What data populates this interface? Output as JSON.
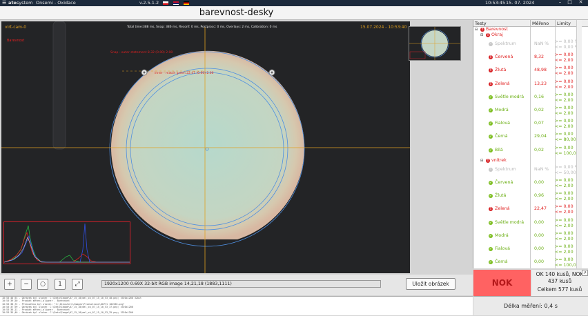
{
  "titlebar": {
    "brand_bold": "ate",
    "brand_rest": "system",
    "app_title": "Onsemi - Oxidace",
    "version": "v.2.5.1.2",
    "time": "10:53:45",
    "date": "15. 07. 2024",
    "menu_icon": "hamburger-icon",
    "minimize": "–",
    "maximize": "□",
    "close": "✕"
  },
  "header": {
    "title": "barevnost-desky"
  },
  "camera": {
    "cam_name": "virt-cam-0",
    "stats": "Total time:388 ms, Snap: 386 ms, Reconf: 0 ms, Postprocc: 0 ms, Overlays: 2 ms, Calibration: 0 ms",
    "timestamp": "15.07.2024 - 10:53:40",
    "label_barevnost": "Barevnost",
    "annot_outer": "Snap - outer statement 8.32 (0.00) 2.00",
    "annot_inner": "inner - match green 22.47 (0.00) 2.00"
  },
  "tree": {
    "col_tests": "Testy",
    "col_measured": "Měřeno",
    "col_limits": "Limity",
    "root_label": "Barevnost",
    "groups": [
      {
        "name": "Okraj",
        "items": [
          {
            "name": "Spektrum",
            "status": "na",
            "value": "NaN %",
            "lim_min": ">= 0,00 %",
            "lim_max": "<= 0,00 %"
          },
          {
            "name": "Červená",
            "status": "err",
            "value": "8,32",
            "lim_min": ">= 0,00",
            "lim_max": "<= 2,00"
          },
          {
            "name": "Žlutá",
            "status": "err",
            "value": "48,98",
            "lim_min": ">= 0,00",
            "lim_max": "<= 2,00"
          },
          {
            "name": "Zelená",
            "status": "err",
            "value": "13,23",
            "lim_min": ">= 0,00",
            "lim_max": "<= 2,00"
          },
          {
            "name": "Světle modrá",
            "status": "ok",
            "value": "0,16",
            "lim_min": ">= 0,00",
            "lim_max": "<= 2,00"
          },
          {
            "name": "Modrá",
            "status": "ok",
            "value": "0,02",
            "lim_min": ">= 0,00",
            "lim_max": "<= 2,00"
          },
          {
            "name": "Fialová",
            "status": "ok",
            "value": "0,07",
            "lim_min": ">= 0,00",
            "lim_max": "<= 2,00"
          },
          {
            "name": "Černá",
            "status": "ok",
            "value": "29,04",
            "lim_min": ">= 0,00",
            "lim_max": "<= 80,00"
          },
          {
            "name": "Bílá",
            "status": "ok",
            "value": "0,02",
            "lim_min": ">= 0,00",
            "lim_max": "<= 100,00"
          }
        ]
      },
      {
        "name": "vnitrek",
        "items": [
          {
            "name": "Spektrum",
            "status": "na",
            "value": "NaN %",
            "lim_min": ">= 0,00 %",
            "lim_max": "<= 50,00 %"
          },
          {
            "name": "Červená",
            "status": "ok",
            "value": "0,00",
            "lim_min": ">= 0,00",
            "lim_max": "<= 2,00"
          },
          {
            "name": "Žlutá",
            "status": "ok",
            "value": "0,96",
            "lim_min": ">= 0,00",
            "lim_max": "<= 2,00"
          },
          {
            "name": "Zelená",
            "status": "err",
            "value": "22,47",
            "lim_min": ">= 0,00",
            "lim_max": "<= 2,00"
          },
          {
            "name": "Světle modrá",
            "status": "ok",
            "value": "0,00",
            "lim_min": ">= 0,00",
            "lim_max": "<= 2,00"
          },
          {
            "name": "Modrá",
            "status": "ok",
            "value": "0,00",
            "lim_min": ">= 0,00",
            "lim_max": "<= 2,00"
          },
          {
            "name": "Fialová",
            "status": "ok",
            "value": "0,00",
            "lim_min": ">= 0,00",
            "lim_max": "<= 2,00"
          },
          {
            "name": "Černá",
            "status": "ok",
            "value": "0,00",
            "lim_min": ">= 0,00",
            "lim_max": "<= 100,00"
          },
          {
            "name": "Bílá",
            "status": "ok",
            "value": "0,00",
            "lim_min": ">= 0,00",
            "lim_max": "<= 100,00"
          }
        ]
      }
    ]
  },
  "toolbar": {
    "zoom_in": "+",
    "zoom_out": "−",
    "zoom_fit": "○",
    "zoom_reset": "1",
    "fullscreen": "⤢",
    "image_info": "1920x1200 0.69X 32-bit RGB image 14,21,18   (1883,1111)",
    "save_label": "Uložit obrázek"
  },
  "result": {
    "status": "NOK",
    "ok_nok": "OK 140 kusů, NOK 437 kusů",
    "total": "Celkem 577 kusů",
    "measure_time": "Délka měření: 0,4 s"
  },
  "log_lines": [
    "10:53:40,91 - Obrázek byl uložen: C:\\Data\\Image\\07_15_10\\mel_ok_07_15_10_53_40.png; 1920x1200 32bit",
    "10:53:39,50 - Produkt měření_aligner - Barevnost",
    "10:53:38,72 - Přeskočeno byl uložen: \"C:\\Ateusters\\Images\\Productions\\00771 10h538.png\"",
    "10:53:37,99 - Obrázek byl uložen: C:\\Data\\Image\\07_15_10\\mel_ok_07_15_10_53_37.png; 1920x1200",
    "10:53:36,11 - Produkt měření_aligner - Barevnost",
    "10:53:35,40 - Obrázek byl uložen: C:\\Data\\Image\\07_15_10\\mel_ok_07_15_10_53_35.png; 1920x1200"
  ],
  "colors": {
    "nok_bg": "#ff6262",
    "err": "#e02020",
    "ok": "#6aae12",
    "accent": "#2f6fc8"
  }
}
